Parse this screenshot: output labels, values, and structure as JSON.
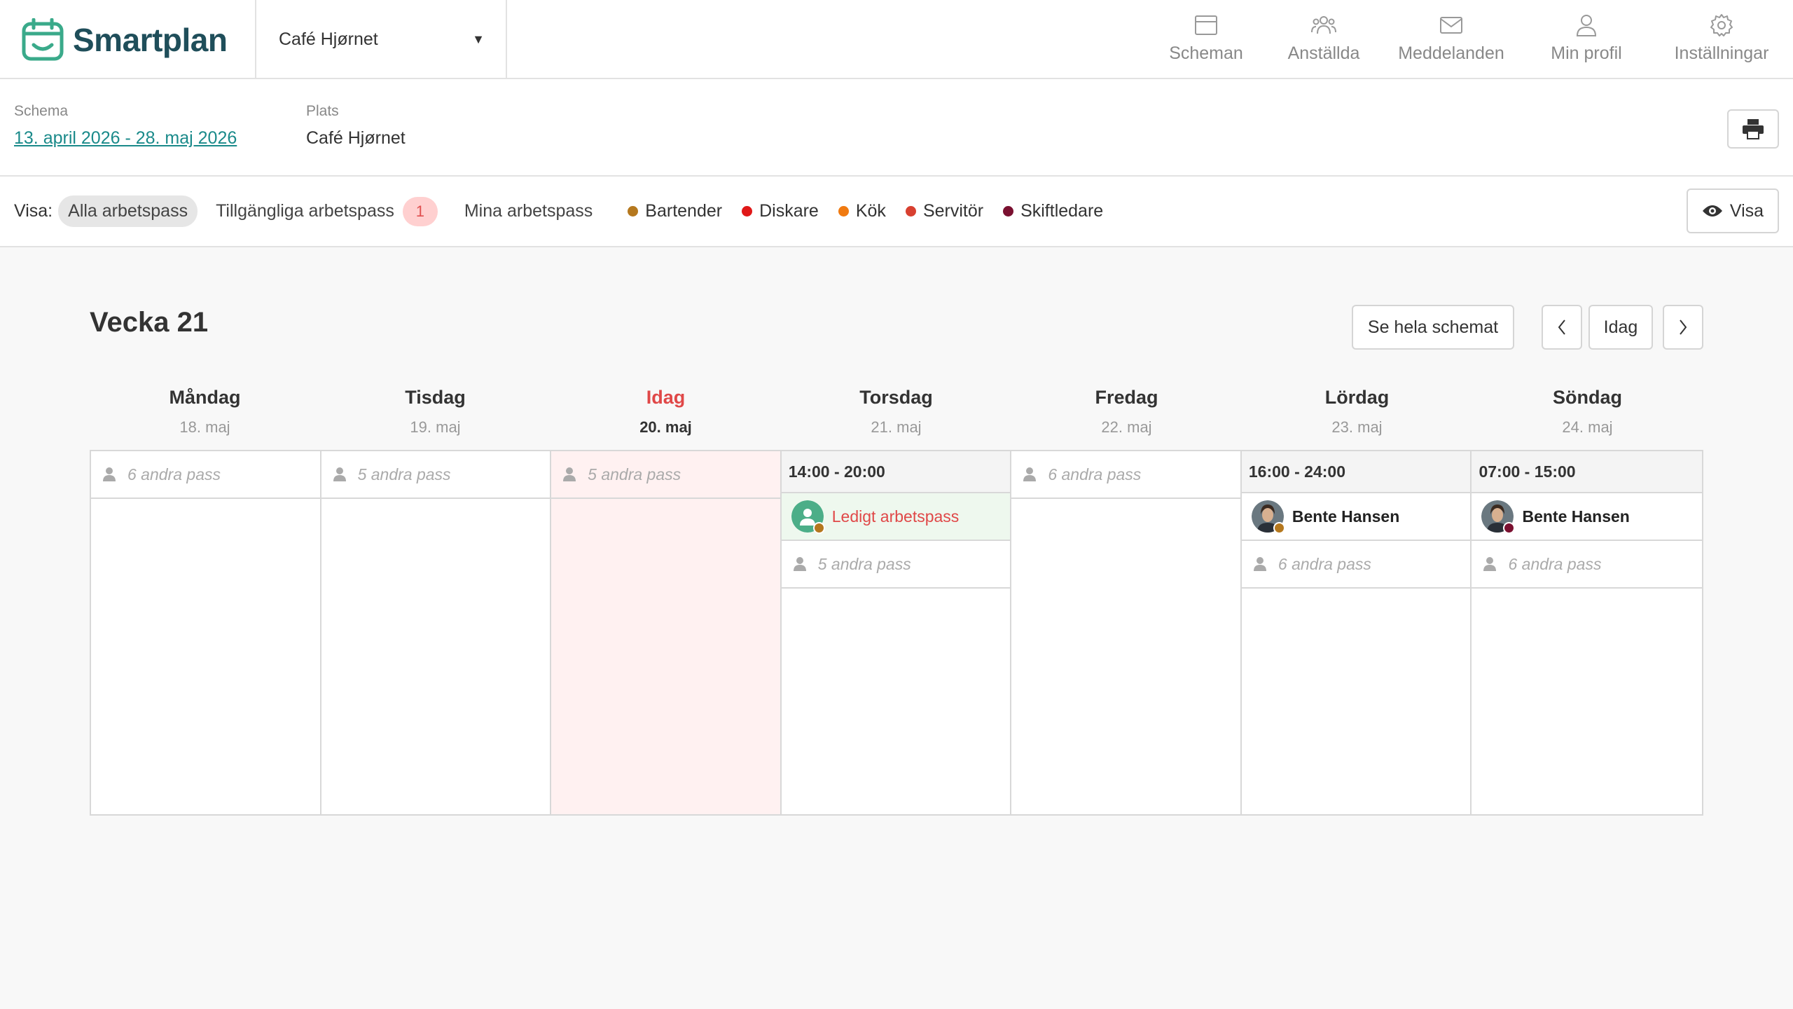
{
  "app": {
    "name": "Smartplan"
  },
  "location_select": {
    "value": "Café Hjørnet"
  },
  "nav": {
    "schedules": "Scheman",
    "employees": "Anställda",
    "messages": "Meddelanden",
    "profile": "Min profil",
    "settings": "Inställningar"
  },
  "schedule_info": {
    "schedule_label": "Schema",
    "schedule_value": "13. april 2026 - 28. maj 2026",
    "place_label": "Plats",
    "place_value": "Café Hjørnet"
  },
  "filters": {
    "label": "Visa:",
    "all": "Alla arbetspass",
    "available": "Tillgängliga arbetspass",
    "available_count": "1",
    "mine": "Mina arbetspass",
    "view_button": "Visa"
  },
  "legend": [
    {
      "label": "Bartender",
      "color": "#b5781e"
    },
    {
      "label": "Diskare",
      "color": "#e01818"
    },
    {
      "label": "Kök",
      "color": "#f07a10"
    },
    {
      "label": "Servitör",
      "color": "#d84030"
    },
    {
      "label": "Skiftledare",
      "color": "#7a1030"
    }
  ],
  "week": {
    "title": "Vecka 21",
    "see_full_schedule": "Se hela schemat",
    "today_button": "Idag"
  },
  "days": [
    {
      "name": "Måndag",
      "date": "18. maj",
      "others": "6 andra pass"
    },
    {
      "name": "Tisdag",
      "date": "19. maj",
      "others": "5 andra pass"
    },
    {
      "name": "Idag",
      "date": "20. maj",
      "others": "5 andra pass"
    },
    {
      "name": "Torsdag",
      "date": "21. maj",
      "shift_time": "14:00 - 20:00",
      "shift_person": "Ledigt arbetspass",
      "others": "5 andra pass"
    },
    {
      "name": "Fredag",
      "date": "22. maj",
      "others": "6 andra pass"
    },
    {
      "name": "Lördag",
      "date": "23. maj",
      "shift_time": "16:00 - 24:00",
      "shift_person": "Bente Hansen",
      "others": "6 andra pass"
    },
    {
      "name": "Söndag",
      "date": "24. maj",
      "shift_time": "07:00 - 15:00",
      "shift_person": "Bente Hansen",
      "others": "6 andra pass"
    }
  ]
}
